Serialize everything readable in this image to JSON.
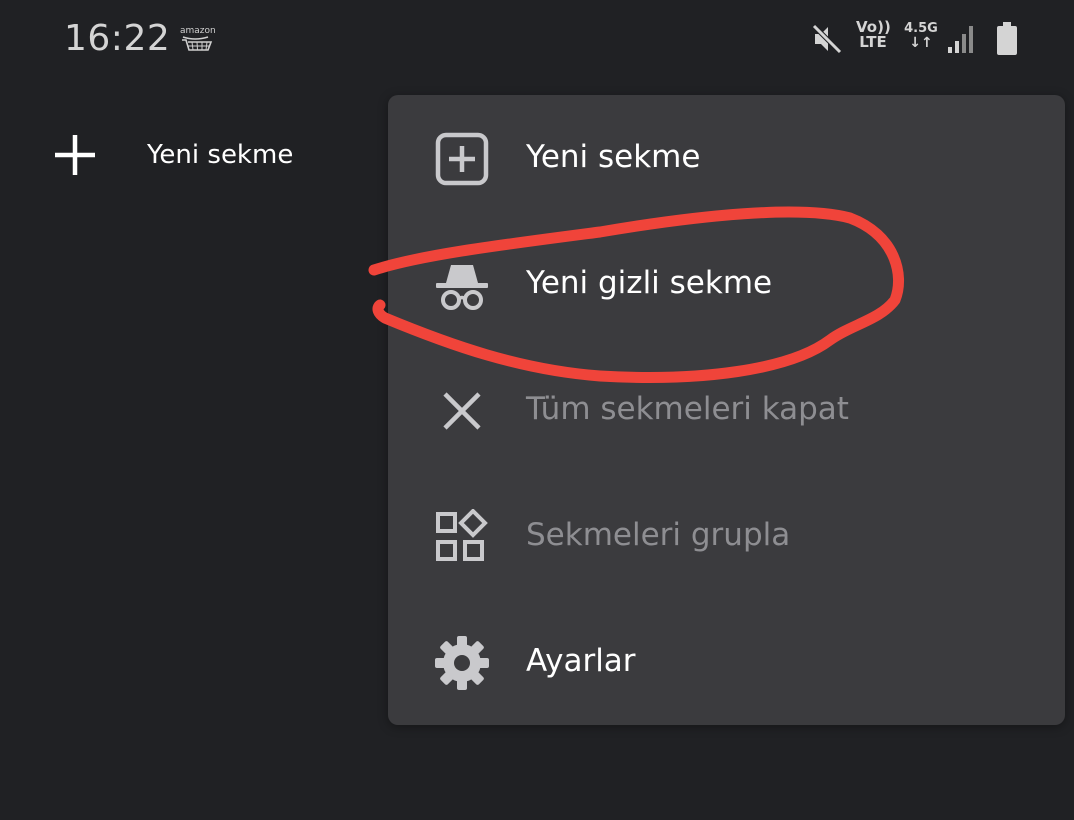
{
  "status_bar": {
    "time": "16:22",
    "amazon_label": "amazon",
    "volte_label": "Vo))",
    "lte_label": "LTE",
    "network_label": "4.5G",
    "network_arrows": "↓↑"
  },
  "background": {
    "new_tab_label": "Yeni sekme"
  },
  "menu": {
    "items": [
      {
        "label": "Yeni sekme",
        "icon": "add-box-icon",
        "enabled": true
      },
      {
        "label": "Yeni gizli sekme",
        "icon": "incognito-icon",
        "enabled": true
      },
      {
        "label": "Tüm sekmeleri kapat",
        "icon": "close-icon",
        "enabled": false
      },
      {
        "label": "Sekmeleri grupla",
        "icon": "group-tabs-icon",
        "enabled": false
      },
      {
        "label": "Ayarlar",
        "icon": "gear-icon",
        "enabled": true
      }
    ]
  },
  "colors": {
    "background": "#202124",
    "menu_background": "#3b3b3e",
    "text_primary": "#ffffff",
    "text_disabled": "#8e8e92",
    "annotation": "#f0443a"
  }
}
